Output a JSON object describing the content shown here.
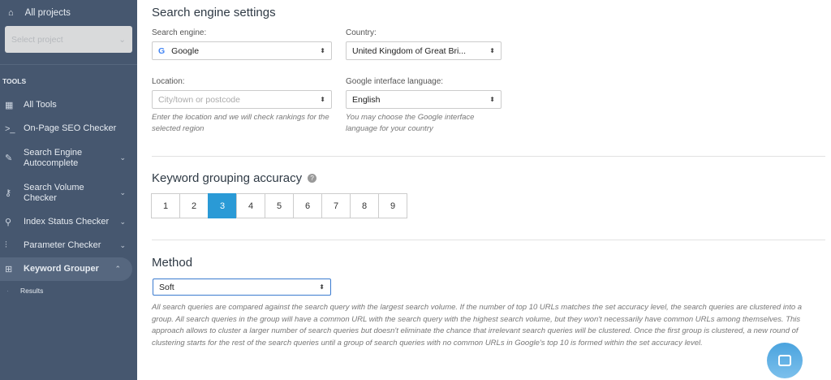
{
  "sidebar": {
    "all_projects": "All projects",
    "select_project_placeholder": "Select project",
    "section": "TOOLS",
    "items": [
      {
        "label": "All Tools",
        "icon": "grid-icon"
      },
      {
        "label": "On-Page SEO Checker",
        "icon": "terminal-icon"
      },
      {
        "label": "Search Engine Autocomplete",
        "icon": "pencil-icon"
      },
      {
        "label": "Search Volume Checker",
        "icon": "key-icon"
      },
      {
        "label": "Index Status Checker",
        "icon": "search-icon"
      },
      {
        "label": "Parameter Checker",
        "icon": "sliders-icon"
      },
      {
        "label": "Keyword Grouper",
        "icon": "folder-plus-icon",
        "active": true
      }
    ],
    "subitems": [
      "Results"
    ]
  },
  "main": {
    "search_title": "Search engine settings",
    "engine_label": "Search engine:",
    "engine_value": "Google",
    "country_label": "Country:",
    "country_value": "United Kingdom of Great Bri...",
    "location_label": "Location:",
    "location_placeholder": "City/town or postcode",
    "location_hint": "Enter the location and we will check rankings for the selected region",
    "language_label": "Google interface language:",
    "language_value": "English",
    "language_hint": "You may choose the Google interface language for your country",
    "accuracy_title": "Keyword grouping accuracy",
    "accuracy_options": [
      "1",
      "2",
      "3",
      "4",
      "5",
      "6",
      "7",
      "8",
      "9"
    ],
    "accuracy_selected": "3",
    "method_title": "Method",
    "method_value": "Soft",
    "method_desc": "All search queries are compared against the search query with the largest search volume. If the number of top 10 URLs matches the set accuracy level, the search queries are clustered into a group. All search queries in the group will have a common URL with the search query with the highest search volume, but they won't necessarily have common URLs among themselves. This approach allows to cluster a larger number of search queries but doesn't eliminate the chance that irrelevant search queries will be clustered. Once the first group is clustered, a new round of clustering starts for the rest of the search queries until a group of search queries with no common URLs in Google's top 10 is formed within the set accuracy level."
  },
  "colors": {
    "sidebar": "#46576f",
    "accent": "#2a9ad6"
  }
}
